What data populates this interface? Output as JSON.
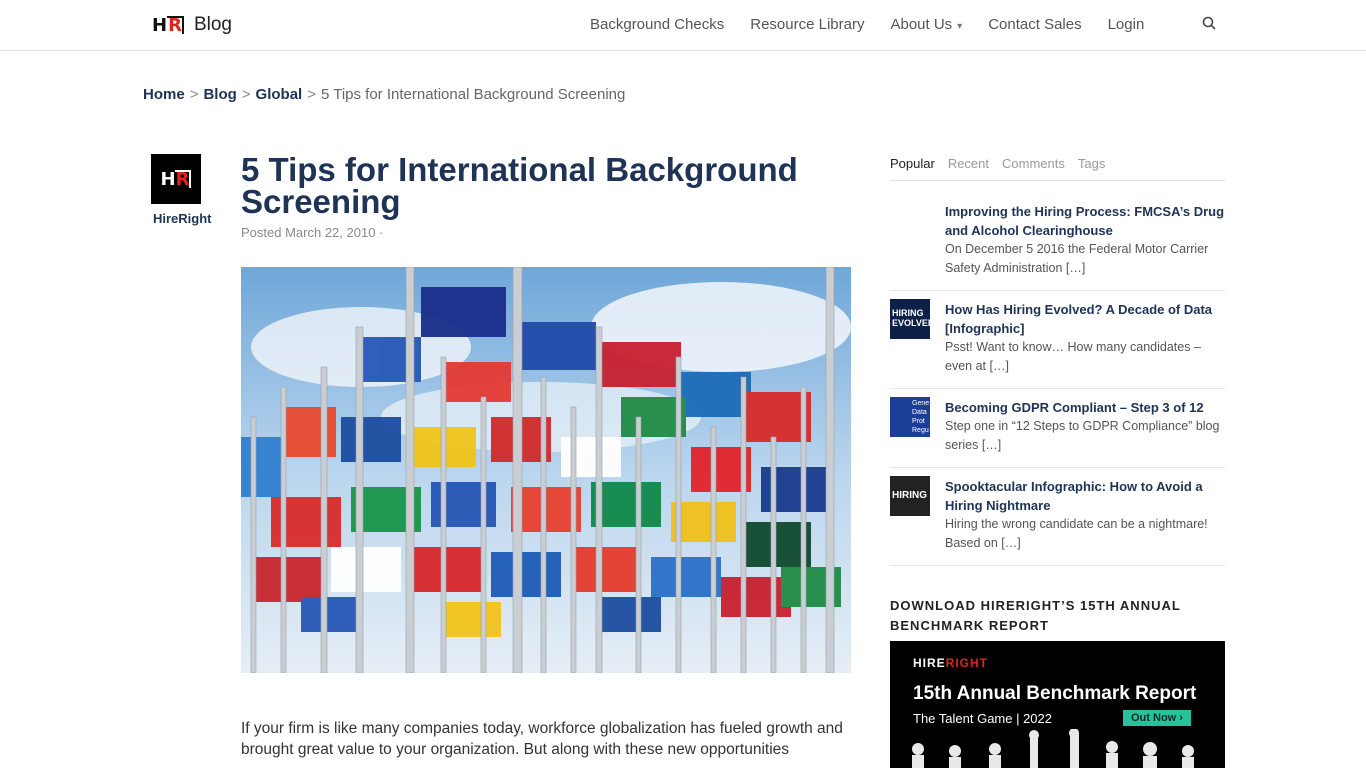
{
  "header": {
    "logo_mark": "H R",
    "logo_text": "Blog",
    "nav": [
      {
        "label": "Background Checks"
      },
      {
        "label": "Resource Library"
      },
      {
        "label": "About Us"
      },
      {
        "label": "Contact Sales"
      },
      {
        "label": "Login"
      }
    ]
  },
  "breadcrumb": {
    "home": "Home",
    "blog": "Blog",
    "global": "Global",
    "current": "5 Tips for International Background Screening",
    "separator": ">"
  },
  "author": {
    "name": "HireRight"
  },
  "article": {
    "title": "5 Tips for International Background Screening",
    "meta": "Posted March 22, 2010 ·",
    "body": "If your firm is like many companies today, workforce globalization has fueled growth and brought great value to your organization. But along with these new opportunities"
  },
  "sidebar": {
    "tabs": [
      "Popular",
      "Recent",
      "Comments",
      "Tags"
    ],
    "posts": [
      {
        "title": "Improving the Hiring Process: FMCSA’s Drug and Alcohol Clearinghouse",
        "excerpt": "On December 5 2016 the Federal Motor Carrier Safety Administration […]"
      },
      {
        "title": "How Has Hiring Evolved? A Decade of Data [Infographic]",
        "excerpt": "Psst! Want to know… How many candidates – even at […]",
        "thumb_text": "HIRING EVOLVED"
      },
      {
        "title": "Becoming GDPR Compliant – Step 3 of 12",
        "excerpt": "Step one in “12 Steps to GDPR Compliance” blog series […]",
        "thumb_text": "Gene Data Prot Regu"
      },
      {
        "title": "Spooktacular Infographic: How to Avoid a Hiring Nightmare",
        "excerpt": "Hiring the wrong candidate can be a nightmare! Based on […]",
        "thumb_text": "HIRING"
      }
    ],
    "download_heading": "DOWNLOAD HIRERIGHT’S 15TH ANNUAL BENCHMARK REPORT",
    "ad": {
      "brand_a": "HIRE",
      "brand_b": "RIGHT",
      "title": "15th Annual Benchmark Report",
      "subtitle": "The Talent Game | 2022",
      "button": "Out Now ›"
    }
  }
}
